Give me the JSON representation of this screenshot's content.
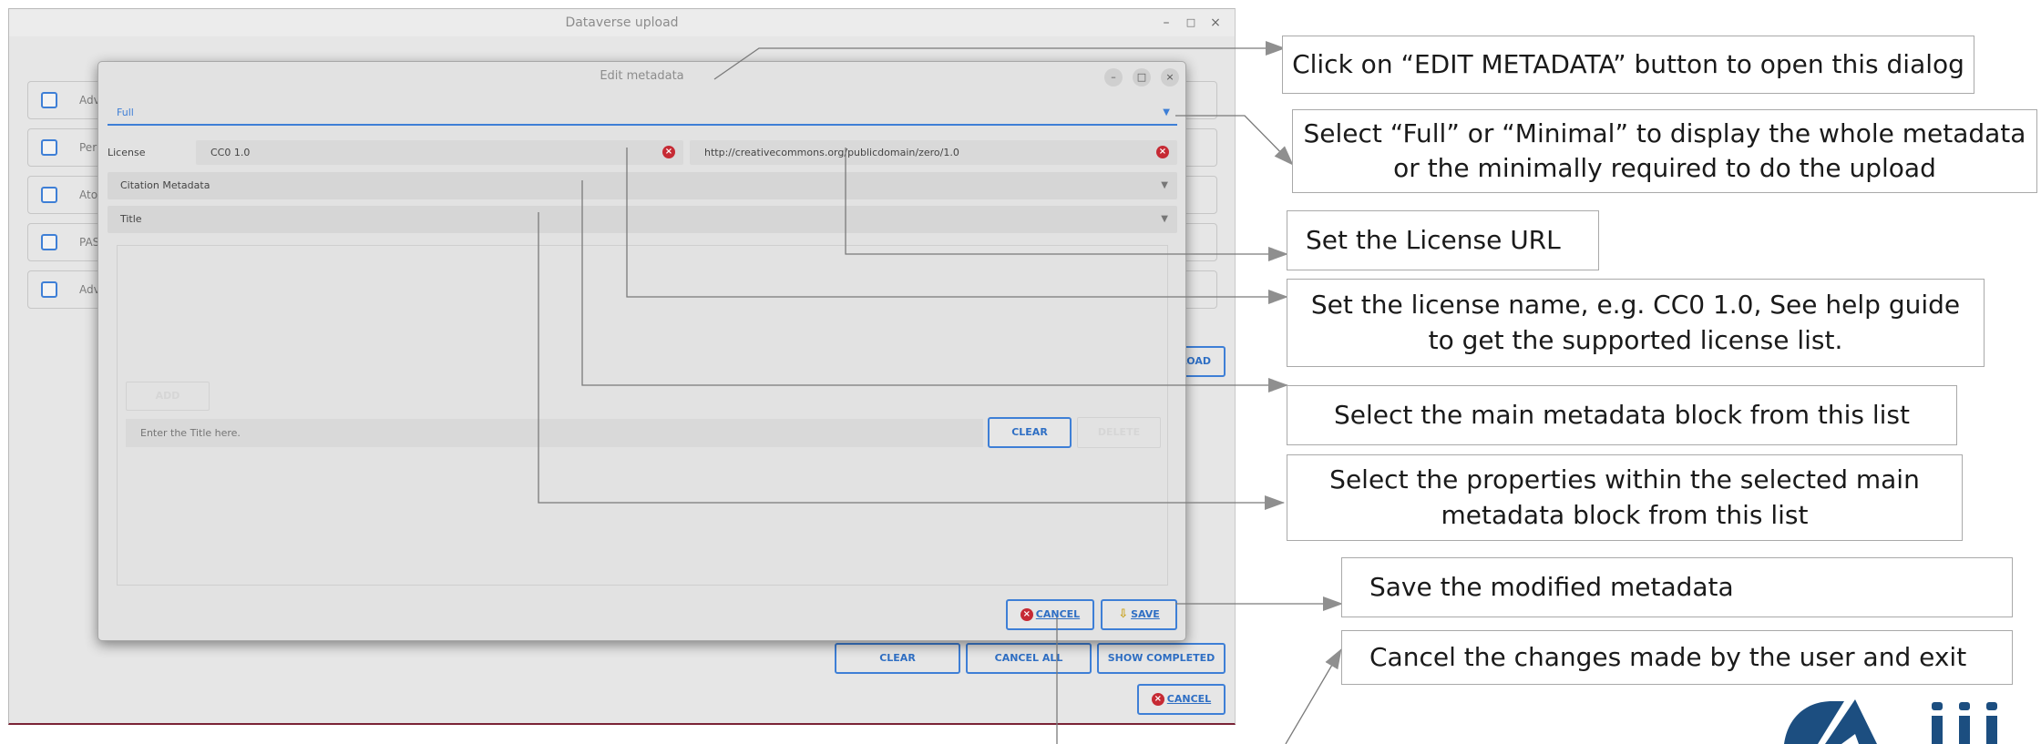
{
  "main_window": {
    "title": "Dataverse upload",
    "controls": {
      "minimize": "–",
      "maximize": "□",
      "close": "×"
    },
    "rows": [
      {
        "label": "Adv"
      },
      {
        "label": "Per"
      },
      {
        "label": "Ato"
      },
      {
        "label": "PAS"
      },
      {
        "label": "Adv"
      }
    ],
    "upload_button_partial": "LOAD",
    "buttons": {
      "clear": "CLEAR",
      "cancel_all": "CANCEL ALL",
      "show_completed": "SHOW COMPLETED",
      "cancel": "CANCEL"
    }
  },
  "dialog": {
    "title": "Edit metadata",
    "controls": {
      "minimize": "–",
      "maximize": "□",
      "close": "×"
    },
    "mode_select": {
      "value": "Full",
      "arrow": "▼"
    },
    "license": {
      "label": "License",
      "name": "CC0 1.0",
      "url": "http://creativecommons.org/publicdomain/zero/1.0"
    },
    "block_select": {
      "value": "Citation Metadata",
      "arrow": "▼"
    },
    "property_select": {
      "value": "Title",
      "arrow": "▼"
    },
    "add_button": "ADD",
    "title_input": {
      "placeholder": "Enter the Title here."
    },
    "clear_button": "CLEAR",
    "delete_button": "DELETE",
    "cancel_button": "CANCEL",
    "save_button": "SAVE"
  },
  "callouts": {
    "edit_metadata": "Click on “EDIT METADATA” button to open this dialog",
    "full_minimal": "Select “Full” or “Minimal” to display the whole metadata or the minimally required to do the upload",
    "license_url": "Set the License URL",
    "license_name": "Set the license name, e.g. CC0 1.0, See help guide to get the supported license list.",
    "main_block": "Select the main metadata block from this list",
    "properties": "Select the properties within the selected main metadata block from this list",
    "save": "Save the modified metadata",
    "cancel": "Cancel the changes made by the user and exit"
  },
  "colors": {
    "accent": "#3e7fd6",
    "danger": "#c62a34",
    "logo": "#1c4e80"
  }
}
